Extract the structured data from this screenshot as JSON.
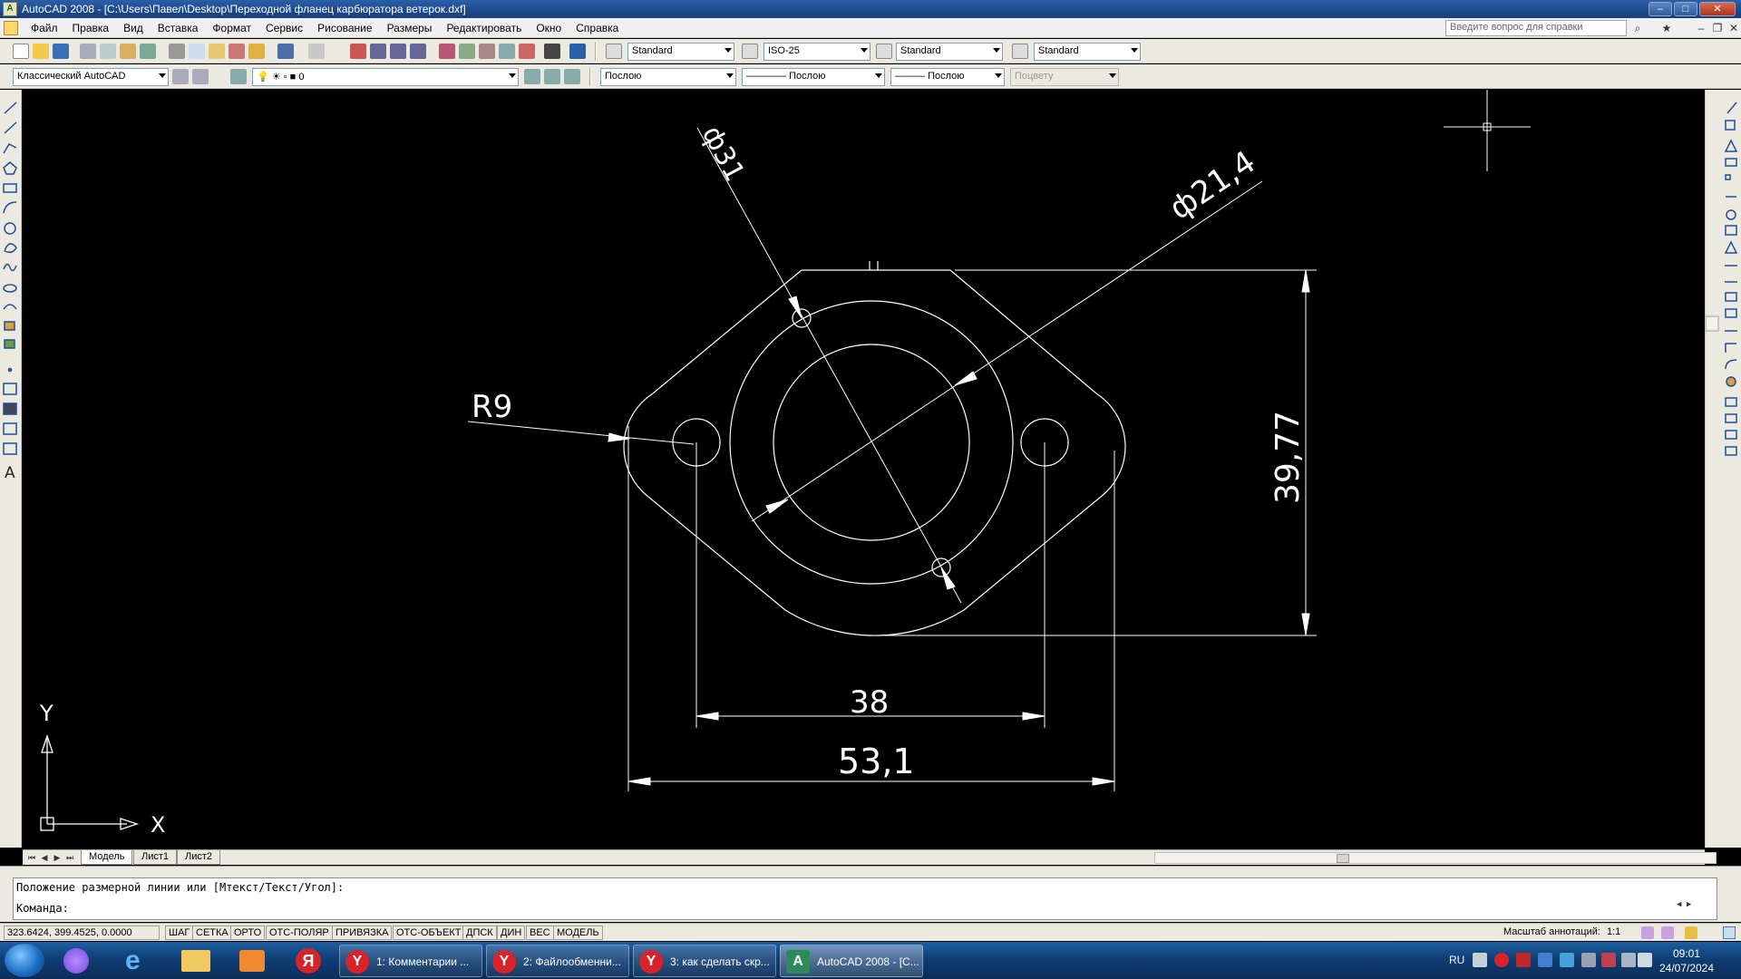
{
  "window": {
    "title": "AutoCAD 2008 - [C:\\Users\\Павел\\Desktop\\Переходной фланец карбюратора ветерок.dxf]"
  },
  "menu": {
    "items": [
      "Файл",
      "Правка",
      "Вид",
      "Вставка",
      "Формат",
      "Сервис",
      "Рисование",
      "Размеры",
      "Редактировать",
      "Окно",
      "Справка"
    ],
    "help_placeholder": "Введите вопрос для справки"
  },
  "toolbar": {
    "text_style": "Standard",
    "dim_style": "ISO-25",
    "table_style": "Standard",
    "mleader_style": "Standard",
    "workspace": "Классический AutoCAD",
    "layer": "0",
    "color": "Послою",
    "linetype": "Послою",
    "lineweight": "Послою",
    "plotstyle": "Поцвету"
  },
  "drawing": {
    "dimensions": {
      "dia_outer": "ф31",
      "dia_inner": "ф21,4",
      "radius": "R9",
      "height": "39,77",
      "holes_distance": "38",
      "overall_width": "53,1"
    },
    "ucs": {
      "x_label": "X",
      "y_label": "Y"
    }
  },
  "tabs": {
    "items": [
      "Модель",
      "Лист1",
      "Лист2"
    ],
    "active": "Модель"
  },
  "command": {
    "history": "Положение размерной линии или [Мтекст/Текст/Угол]:",
    "prompt": "Команда:"
  },
  "status": {
    "coords": "323.6424, 399.4525, 0.0000",
    "buttons": [
      "ШАГ",
      "СЕТКА",
      "ОРТО",
      "ОТС-ПОЛЯР",
      "ПРИВЯЗКА",
      "ОТС-ОБЪЕКТ",
      "ДПСК",
      "ДИН",
      "ВЕС",
      "МОДЕЛЬ"
    ],
    "annotation_scale_label": "Масштаб аннотаций:",
    "annotation_scale": "1:1"
  },
  "taskbar": {
    "tasks": [
      {
        "label": "1: Комментарии ...",
        "icon": "Y"
      },
      {
        "label": "2: Файлообменни...",
        "icon": "Y"
      },
      {
        "label": "3: как сделать скр...",
        "icon": "Y"
      },
      {
        "label": "AutoCAD 2008 - [C...",
        "icon": "A"
      }
    ],
    "language": "RU",
    "time": "09:01",
    "date": "24/07/2024"
  },
  "colors": {
    "background": "#000000",
    "geometry": "#ffffff",
    "toolbar": "#ece9e0",
    "taskbar": "#0f3e75"
  }
}
